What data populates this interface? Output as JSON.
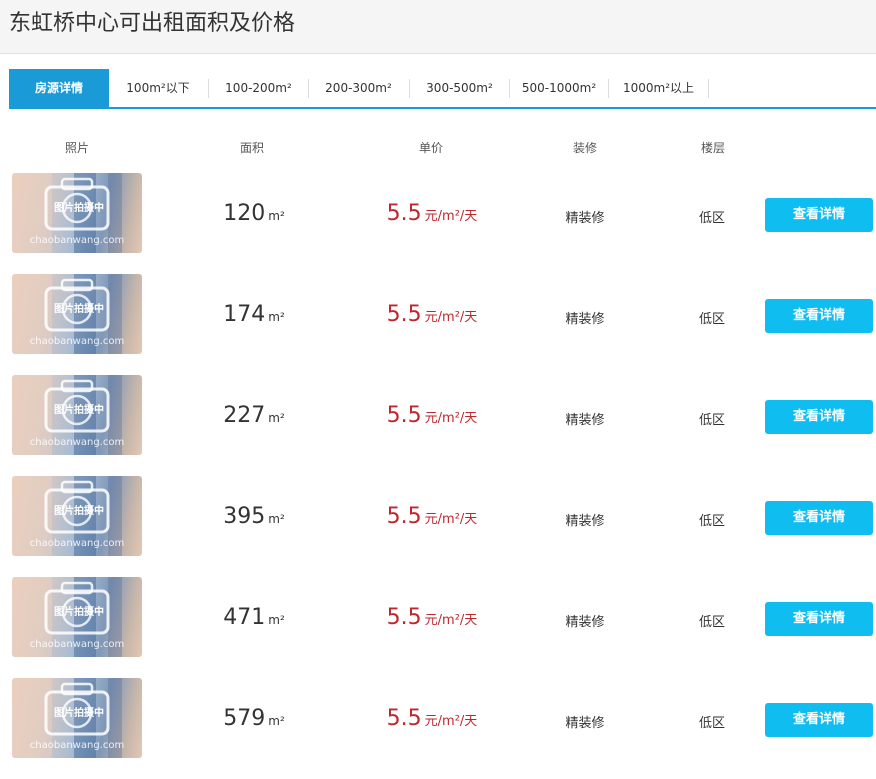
{
  "header": {
    "title": "东虹桥中心可出租面积及价格"
  },
  "tabs": [
    {
      "label": "房源详情",
      "active": true
    },
    {
      "label": "100m²以下",
      "active": false
    },
    {
      "label": "100-200m²",
      "active": false
    },
    {
      "label": "200-300m²",
      "active": false
    },
    {
      "label": "300-500m²",
      "active": false
    },
    {
      "label": "500-1000m²",
      "active": false
    },
    {
      "label": "1000m²以上",
      "active": false
    }
  ],
  "columns": {
    "photo": "照片",
    "area": "面积",
    "price": "单价",
    "decoration": "装修",
    "floor": "楼层"
  },
  "photo_placeholder": {
    "overlay_text": "图片拍摄中",
    "watermark": "chaobanwang.com"
  },
  "area_unit": "m²",
  "price_unit": "元/m²/天",
  "listings": [
    {
      "area": "120",
      "price": "5.5",
      "decoration": "精装修",
      "floor": "低区",
      "button": "查看详情"
    },
    {
      "area": "174",
      "price": "5.5",
      "decoration": "精装修",
      "floor": "低区",
      "button": "查看详情"
    },
    {
      "area": "227",
      "price": "5.5",
      "decoration": "精装修",
      "floor": "低区",
      "button": "查看详情"
    },
    {
      "area": "395",
      "price": "5.5",
      "decoration": "精装修",
      "floor": "低区",
      "button": "查看详情"
    },
    {
      "area": "471",
      "price": "5.5",
      "decoration": "精装修",
      "floor": "低区",
      "button": "查看详情"
    },
    {
      "area": "579",
      "price": "5.5",
      "decoration": "精装修",
      "floor": "低区",
      "button": "查看详情"
    }
  ],
  "colors": {
    "accent": "#1a9bd8",
    "button": "#10bdf0",
    "price": "#c0272d"
  }
}
